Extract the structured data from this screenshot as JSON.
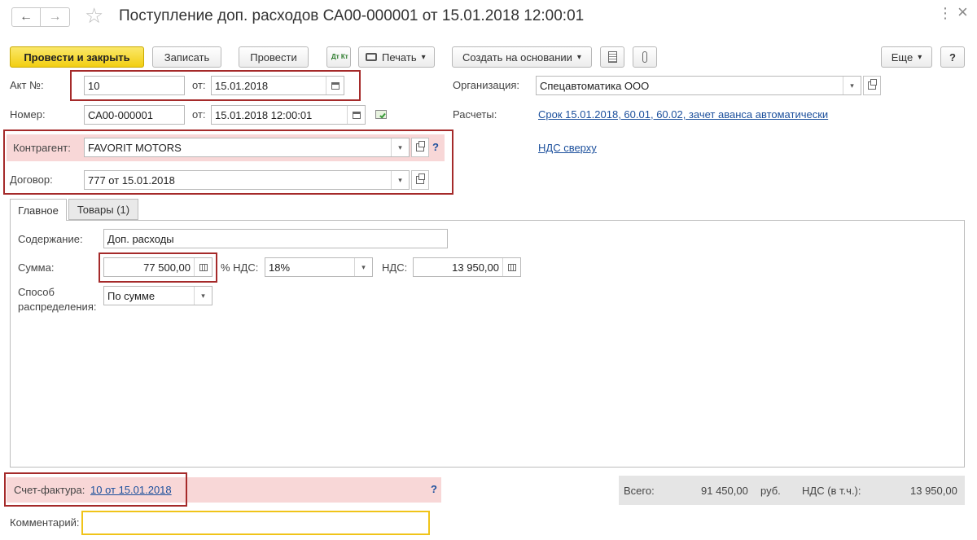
{
  "header": {
    "title": "Поступление доп. расходов СА00-000001 от 15.01.2018 12:00:01",
    "back_glyph": "←",
    "forward_glyph": "→",
    "star_glyph": "☆",
    "close_glyph": "×",
    "more_glyph": "⋮"
  },
  "toolbar": {
    "post_close": "Провести и закрыть",
    "save": "Записать",
    "post": "Провести",
    "dtkt": "Дт Кт",
    "print": "Печать",
    "create_based": "Создать на основании",
    "more": "Еще",
    "help": "?",
    "dropdown_glyph": "▾",
    "attach_glyph": "📎"
  },
  "form": {
    "act_label": "Акт №:",
    "act_value": "10",
    "from_label": "от:",
    "act_date": "15.01.2018",
    "number_label": "Номер:",
    "number_value": "СА00-000001",
    "number_date": "15.01.2018 12:00:01",
    "org_label": "Организация:",
    "org_value": "Спецавтоматика ООО",
    "calc_label": "Расчеты:",
    "calc_link": "Срок 15.01.2018, 60.01, 60.02, зачет аванса автоматически",
    "vat_link": "НДС сверху",
    "contractor_label": "Контрагент:",
    "contractor_value": "FAVORIT MOTORS",
    "contract_label": "Договор:",
    "contract_value": "777 от 15.01.2018",
    "question": "?"
  },
  "tabs": [
    {
      "label": "Главное",
      "active": true
    },
    {
      "label": "Товары (1)",
      "active": false
    }
  ],
  "main": {
    "content_label": "Содержание:",
    "content_value": "Доп. расходы",
    "sum_label": "Сумма:",
    "sum_value": "77 500,00",
    "vat_rate_label": "% НДС:",
    "vat_rate_value": "18%",
    "vat_label": "НДС:",
    "vat_value": "13 950,00",
    "method_label_1": "Способ",
    "method_label_2": "распределения:",
    "method_value": "По сумме"
  },
  "footer": {
    "invoice_label": "Счет-фактура:",
    "invoice_link": "10 от 15.01.2018",
    "question": "?",
    "total_label": "Всего:",
    "total_value": "91 450,00",
    "currency": "руб.",
    "vat_incl_label": "НДС (в т.ч.):",
    "vat_incl_value": "13 950,00",
    "comment_label": "Комментарий:",
    "comment_value": ""
  },
  "colors": {
    "accent_yellow": "#f5d31c",
    "highlight_red": "#a52a2a",
    "pink_row": "#f8d7d7",
    "link": "#1b4f9c",
    "totals_bg": "#e5e5e5",
    "comment_border": "#f0c419"
  }
}
